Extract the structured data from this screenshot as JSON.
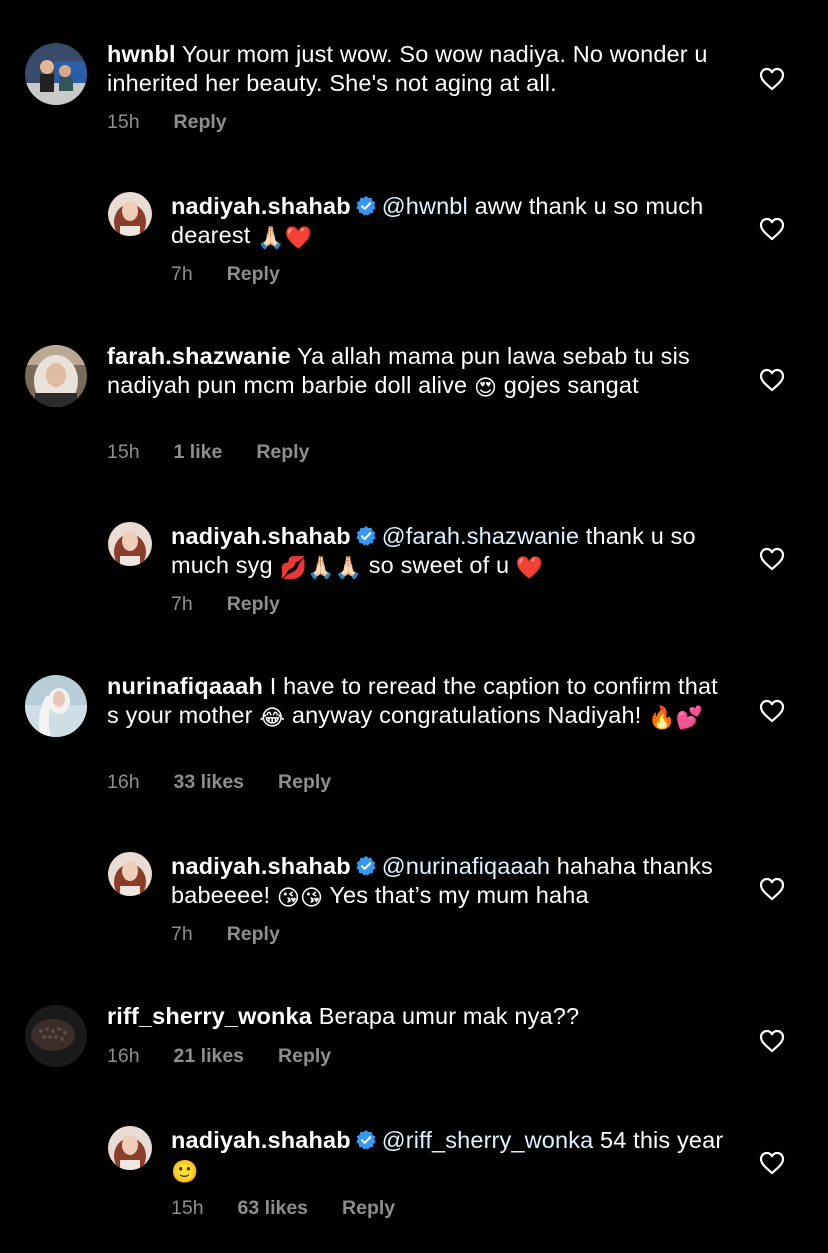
{
  "comments": [
    {
      "id": "c1",
      "username": "hwnbl",
      "text": "Your mom just wow. So wow nadiya. No wonder u inherited her beauty. She's not aging at all.",
      "time": "15h",
      "likes": "",
      "reply_label": "Reply"
    },
    {
      "id": "r1",
      "username": "nadiyah.shahab",
      "verified": true,
      "mention": "@hwnbl",
      "text_1": "aww thank u so much dearest",
      "emoji_1": "🙏🏻",
      "emoji_2": "❤️",
      "time": "7h",
      "likes": "",
      "reply_label": "Reply"
    },
    {
      "id": "c2",
      "username": "farah.shazwanie",
      "text_1": "Ya allah mama pun lawa sebab tu sis nadiyah pun mcm barbie doll alive",
      "emoji_1": "😍",
      "text_2": "gojes sangat",
      "time": "15h",
      "likes": "1 like",
      "reply_label": "Reply"
    },
    {
      "id": "r2",
      "username": "nadiyah.shahab",
      "verified": true,
      "mention": "@farah.shazwanie",
      "text_1": "thank u so much syg",
      "emoji_1": "💋",
      "emoji_2": "🙏🏻",
      "emoji_3": "🙏🏻",
      "text_2": "so sweet of u",
      "emoji_4": "❤️",
      "time": "7h",
      "likes": "",
      "reply_label": "Reply"
    },
    {
      "id": "c3",
      "username": "nurinafiqaaah",
      "text_1": "I have to reread the caption to confirm that s your mother",
      "emoji_1": "😂",
      "text_2": "anyway congratulations Nadiyah!",
      "emoji_2": "🔥",
      "emoji_3": "💕",
      "time": "16h",
      "likes": "33 likes",
      "reply_label": "Reply"
    },
    {
      "id": "r3",
      "username": "nadiyah.shahab",
      "verified": true,
      "mention": "@nurinafiqaaah",
      "text_1": "hahaha thanks babeeee!",
      "emoji_1": "😘",
      "emoji_2": "😘",
      "text_2": "Yes that’s my mum haha",
      "time": "7h",
      "likes": "",
      "reply_label": "Reply"
    },
    {
      "id": "c4",
      "username": "riff_sherry_wonka",
      "text": "Berapa umur mak nya??",
      "time": "16h",
      "likes": "21 likes",
      "reply_label": "Reply"
    },
    {
      "id": "r4",
      "username": "nadiyah.shahab",
      "verified": true,
      "mention": "@riff_sherry_wonka",
      "text_1": "54 this year",
      "emoji_1": "🙂",
      "time": "15h",
      "likes": "63 likes",
      "reply_label": "Reply"
    }
  ],
  "colors": {
    "background": "#000000",
    "text": "#ffffff",
    "meta": "#8e8e8e",
    "mention": "#e0f1ff",
    "verified": "#3897f0"
  },
  "icons": {
    "like": "heart-outline-icon",
    "verified": "verified-badge-icon"
  }
}
